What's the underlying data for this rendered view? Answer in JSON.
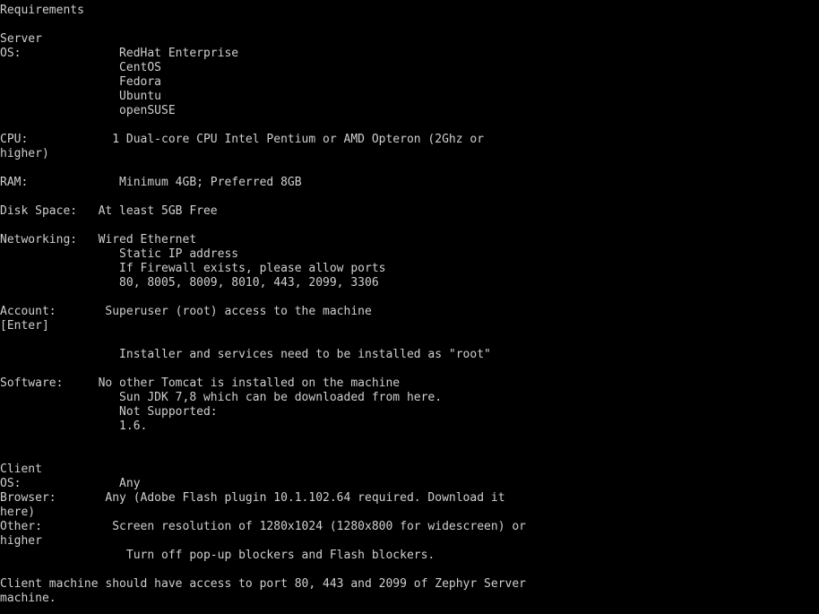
{
  "document": {
    "title": "Requirements",
    "background_color": "#000000",
    "text_color": "#cfcfcf",
    "sections": {
      "server_heading": "Server",
      "client_heading": "Client"
    },
    "lines": [
      "Requirements",
      "",
      "Server",
      "OS:              RedHat Enterprise",
      "                 CentOS",
      "                 Fedora",
      "                 Ubuntu",
      "                 openSUSE",
      "",
      "CPU:            1 Dual-core CPU Intel Pentium or AMD Opteron (2Ghz or",
      "higher)",
      "",
      "RAM:             Minimum 4GB; Preferred 8GB",
      "",
      "Disk Space:   At least 5GB Free",
      "",
      "Networking:   Wired Ethernet",
      "                 Static IP address",
      "                 If Firewall exists, please allow ports",
      "                 80, 8005, 8009, 8010, 443, 2099, 3306",
      "",
      "Account:       Superuser (root) access to the machine",
      "[Enter]",
      "",
      "                 Installer and services need to be installed as \"root\"",
      "",
      "Software:     No other Tomcat is installed on the machine",
      "                 Sun JDK 7,8 which can be downloaded from here.",
      "                 Not Supported:",
      "                 1.6.",
      "",
      "",
      "Client",
      "OS:              Any",
      "Browser:       Any (Adobe Flash plugin 10.1.102.64 required. Download it",
      "here)",
      "Other:          Screen resolution of 1280x1024 (1280x800 for widescreen) or",
      "higher",
      "                  Turn off pop-up blockers and Flash blockers.",
      "",
      "Client machine should have access to port 80, 443 and 2099 of Zephyr Server",
      "machine."
    ],
    "requirements": {
      "server": {
        "os": {
          "label": "OS:",
          "values": [
            "RedHat Enterprise",
            "CentOS",
            "Fedora",
            "Ubuntu",
            "openSUSE"
          ]
        },
        "cpu": {
          "label": "CPU:",
          "value": "1 Dual-core CPU Intel Pentium or AMD Opteron (2Ghz or higher)"
        },
        "ram": {
          "label": "RAM:",
          "value": "Minimum 4GB; Preferred 8GB"
        },
        "disk_space": {
          "label": "Disk Space:",
          "value": "At least 5GB Free"
        },
        "networking": {
          "label": "Networking:",
          "values": [
            "Wired Ethernet",
            "Static IP address",
            "If Firewall exists, please allow ports",
            "80, 8005, 8009, 8010, 443, 2099, 3306"
          ]
        },
        "account": {
          "label": "Account:",
          "value": "Superuser (root) access to the machine [Enter]",
          "note": "Installer and services need to be installed as \"root\""
        },
        "software": {
          "label": "Software:",
          "values": [
            "No other Tomcat is installed on the machine",
            "Sun JDK 7,8 which can be downloaded from here.",
            "Not Supported:",
            "1.6."
          ]
        }
      },
      "client": {
        "os": {
          "label": "OS:",
          "value": "Any"
        },
        "browser": {
          "label": "Browser:",
          "value": "Any (Adobe Flash plugin 10.1.102.64 required. Download it here)"
        },
        "other": {
          "label": "Other:",
          "values": [
            "Screen resolution of 1280x1024 (1280x800 for widescreen) or higher",
            "Turn off pop-up blockers and Flash blockers."
          ]
        },
        "footer": "Client machine should have access to port 80, 443 and 2099 of Zephyr Server machine."
      }
    }
  }
}
